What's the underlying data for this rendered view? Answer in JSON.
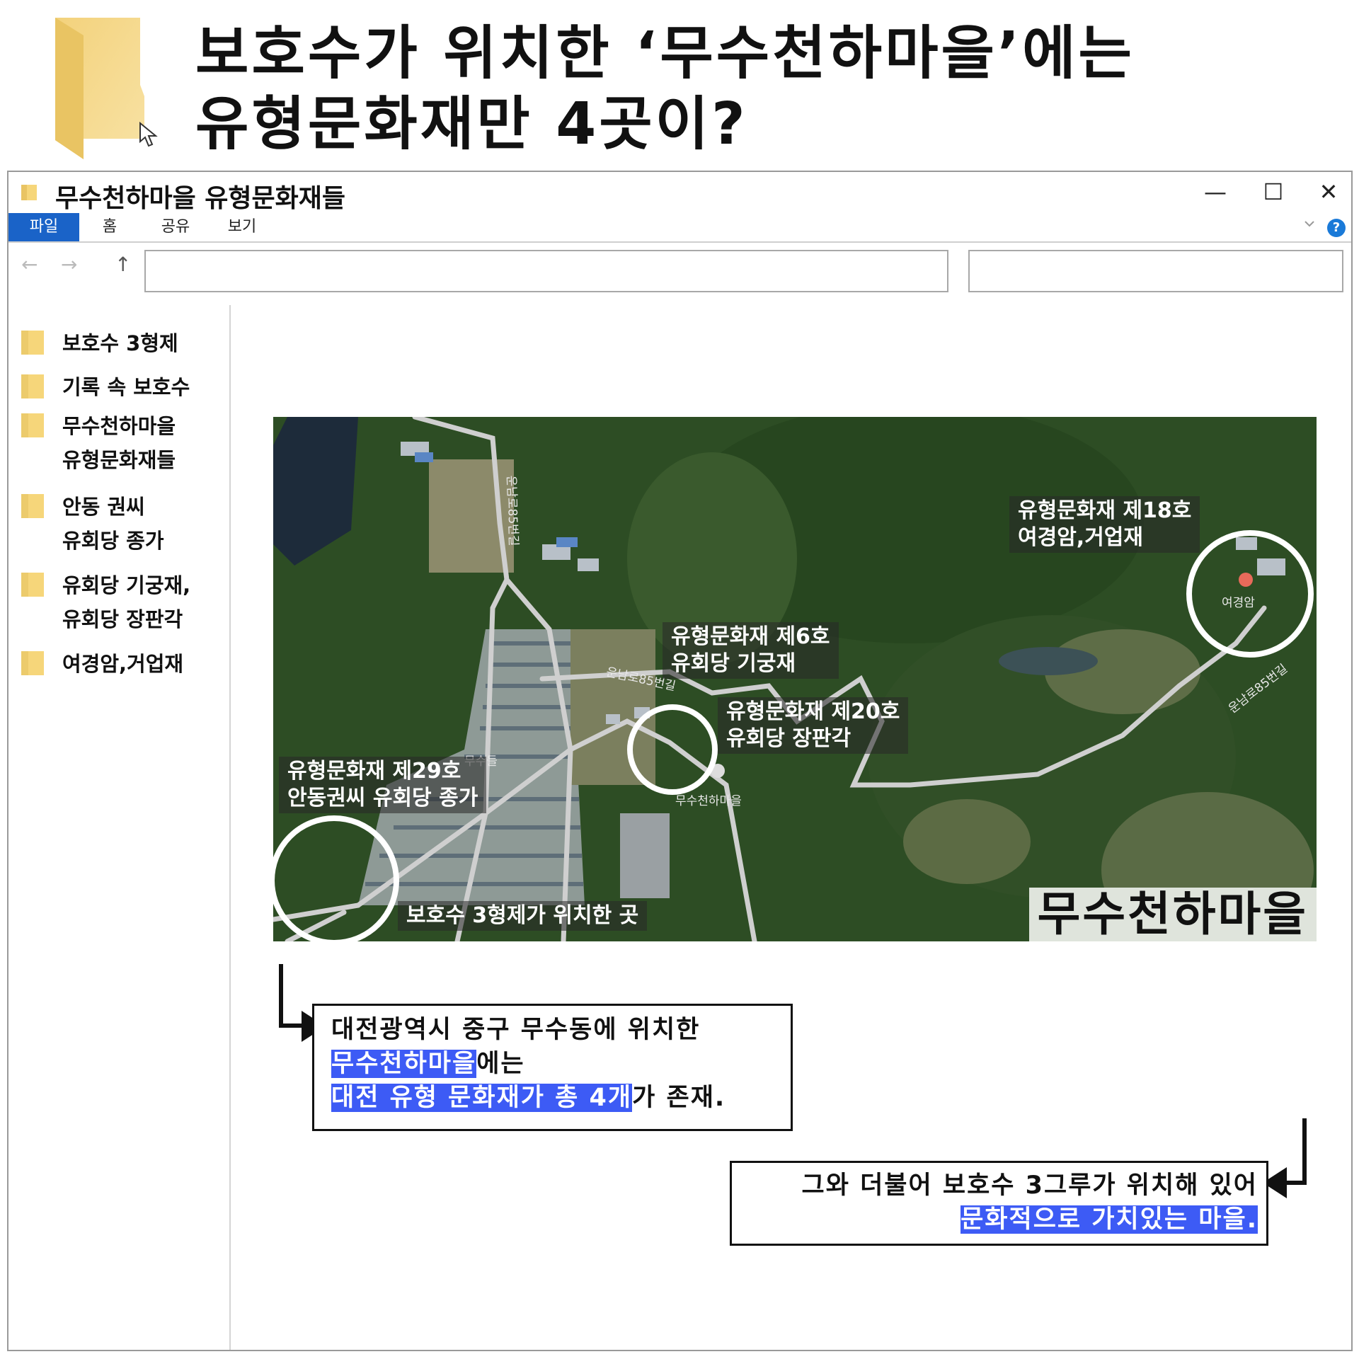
{
  "header": {
    "title_line1": "보호수가 위치한 ‘무수천하마을’에는",
    "title_line2": "유형문화재만 4곳이?"
  },
  "window": {
    "title": "무수천하마을 유형문화재들",
    "minimize": "—",
    "maximize": "☐",
    "close": "✕",
    "ribbon_tabs": [
      "파일",
      "홈",
      "공유",
      "보기"
    ],
    "help": "?",
    "nav": {
      "back": "←",
      "forward": "→",
      "up": "↑"
    }
  },
  "sidebar": {
    "items": [
      {
        "lines": [
          "보호수 3형제"
        ]
      },
      {
        "lines": [
          "기록 속 보호수"
        ]
      },
      {
        "lines": [
          "무수천하마을",
          "유형문화재들"
        ]
      },
      {
        "lines": [
          "안동 권씨",
          "유회당 종가"
        ]
      },
      {
        "lines": [
          "유회당 기궁재,",
          "유회당 장판각"
        ]
      },
      {
        "lines": [
          "여경암,거업재"
        ]
      }
    ]
  },
  "map": {
    "labels": [
      {
        "lines": [
          "유형문화재 제18호",
          "여경암,거업재"
        ]
      },
      {
        "lines": [
          "유형문화재 제6호",
          "유회당 기궁재"
        ]
      },
      {
        "lines": [
          "유형문화재 제20호",
          "유회당 장판각"
        ]
      },
      {
        "lines": [
          "유형문화재 제29호",
          "안동권씨 유회당 종가"
        ]
      },
      {
        "lines": [
          "보호수 3형제가 위치한 곳"
        ]
      }
    ],
    "place_marker_yeogyeongam": "여경암",
    "place_marker_village": "무수천하마을",
    "road_label_1": "운남로85번길",
    "road_label_2": "운남로85번길",
    "road_label_3": "운남로85번길",
    "village_area_label": "무수들",
    "village_name": "무수천하마을"
  },
  "callout1": {
    "line1": "대전광역시 중구 무수동에 위치한",
    "line2_highlight": "무수천하마을",
    "line2_rest": "에는",
    "line3_highlight": "대전 유형 문화재가 총 4개",
    "line3_rest": "가 존재."
  },
  "callout2": {
    "line1": "그와 더불어 보호수 3그루가 위치해 있어",
    "line2_highlight": "문화적으로 가치있는 마을."
  },
  "colors": {
    "accent_blue": "#1a63c8",
    "highlight": "#3d5bf5",
    "folder_yellow": "#f6d67a"
  }
}
